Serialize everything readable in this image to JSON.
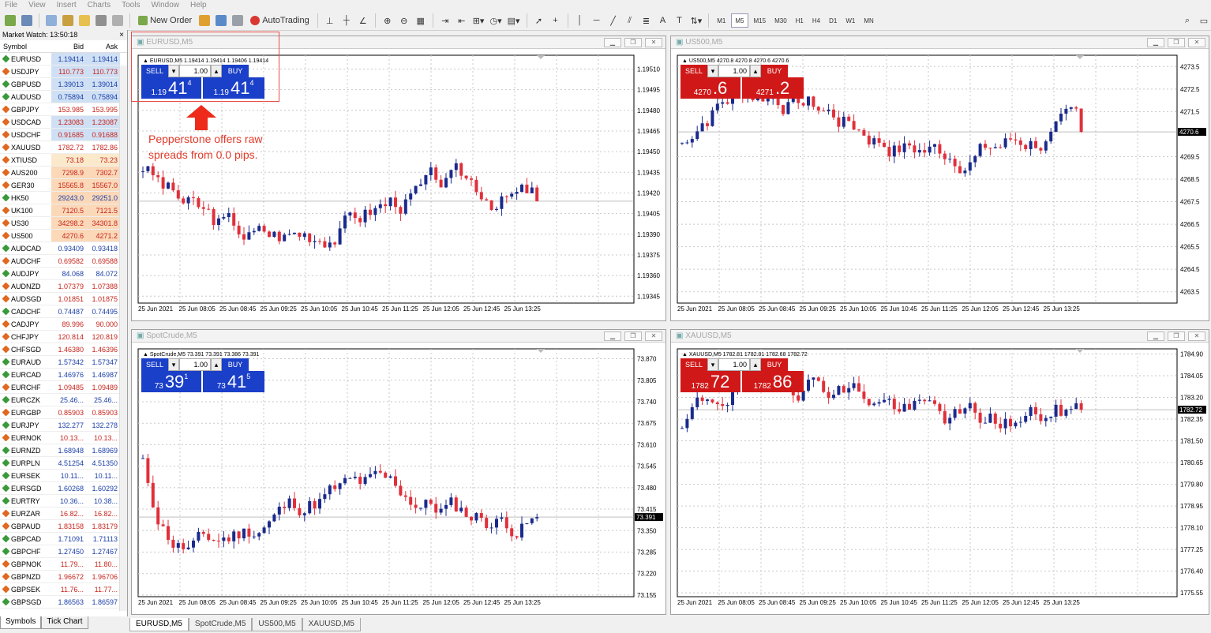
{
  "menu": [
    "File",
    "View",
    "Insert",
    "Charts",
    "Tools",
    "Window",
    "Help"
  ],
  "toolbar": {
    "new_order": "New Order",
    "autotrading": "AutoTrading",
    "timeframes": [
      "M1",
      "M5",
      "M15",
      "M30",
      "H1",
      "H4",
      "D1",
      "W1",
      "MN"
    ],
    "active_tf": "M5"
  },
  "market_watch": {
    "title": "Market Watch: 13:50:18",
    "headers": {
      "symbol": "Symbol",
      "bid": "Bid",
      "ask": "Ask"
    },
    "rows": [
      {
        "s": "EURUSD",
        "b": "1.19414",
        "a": "1.19414",
        "d": "up",
        "bg": "#cfe0f4",
        "c": "#1a3ea8"
      },
      {
        "s": "USDJPY",
        "b": "110.773",
        "a": "110.773",
        "d": "down",
        "bg": "#cfe0f4",
        "c": "#c8241b"
      },
      {
        "s": "GBPUSD",
        "b": "1.39013",
        "a": "1.39014",
        "d": "up",
        "bg": "#cfe0f4",
        "c": "#1a3ea8"
      },
      {
        "s": "AUDUSD",
        "b": "0.75894",
        "a": "0.75894",
        "d": "up",
        "bg": "#cfe0f4",
        "c": "#1a3ea8"
      },
      {
        "s": "GBPJPY",
        "b": "153.985",
        "a": "153.995",
        "d": "down",
        "bg": "#fff",
        "c": "#c8241b"
      },
      {
        "s": "USDCAD",
        "b": "1.23083",
        "a": "1.23087",
        "d": "down",
        "bg": "#cfe0f4",
        "c": "#c8241b"
      },
      {
        "s": "USDCHF",
        "b": "0.91685",
        "a": "0.91688",
        "d": "down",
        "bg": "#cfe0f4",
        "c": "#c8241b"
      },
      {
        "s": "XAUUSD",
        "b": "1782.72",
        "a": "1782.86",
        "d": "down",
        "bg": "#fff",
        "c": "#c8241b"
      },
      {
        "s": "XTIUSD",
        "b": "73.18",
        "a": "73.23",
        "d": "down",
        "bg": "#fbe9cc",
        "c": "#c8241b"
      },
      {
        "s": "AUS200",
        "b": "7298.9",
        "a": "7302.7",
        "d": "down",
        "bg": "#fbd8b8",
        "c": "#c8241b"
      },
      {
        "s": "GER30",
        "b": "15565.8",
        "a": "15567.0",
        "d": "down",
        "bg": "#fbd8b8",
        "c": "#c8241b"
      },
      {
        "s": "HK50",
        "b": "29243.0",
        "a": "29251.0",
        "d": "up",
        "bg": "#fbd8b8",
        "c": "#1a3ea8"
      },
      {
        "s": "UK100",
        "b": "7120.5",
        "a": "7121.5",
        "d": "down",
        "bg": "#fbd8b8",
        "c": "#c8241b"
      },
      {
        "s": "US30",
        "b": "34298.2",
        "a": "34301.8",
        "d": "down",
        "bg": "#fbd8b8",
        "c": "#c8241b"
      },
      {
        "s": "US500",
        "b": "4270.6",
        "a": "4271.2",
        "d": "down",
        "bg": "#fbd8b8",
        "c": "#c8241b"
      },
      {
        "s": "AUDCAD",
        "b": "0.93409",
        "a": "0.93418",
        "d": "up",
        "bg": "#fff",
        "c": "#1a3ea8"
      },
      {
        "s": "AUDCHF",
        "b": "0.69582",
        "a": "0.69588",
        "d": "down",
        "bg": "#fff",
        "c": "#c8241b"
      },
      {
        "s": "AUDJPY",
        "b": "84.068",
        "a": "84.072",
        "d": "up",
        "bg": "#fff",
        "c": "#1a3ea8"
      },
      {
        "s": "AUDNZD",
        "b": "1.07379",
        "a": "1.07388",
        "d": "down",
        "bg": "#fff",
        "c": "#c8241b"
      },
      {
        "s": "AUDSGD",
        "b": "1.01851",
        "a": "1.01875",
        "d": "down",
        "bg": "#fff",
        "c": "#c8241b"
      },
      {
        "s": "CADCHF",
        "b": "0.74487",
        "a": "0.74495",
        "d": "up",
        "bg": "#fff",
        "c": "#1a3ea8"
      },
      {
        "s": "CADJPY",
        "b": "89.996",
        "a": "90.000",
        "d": "down",
        "bg": "#fff",
        "c": "#c8241b"
      },
      {
        "s": "CHFJPY",
        "b": "120.814",
        "a": "120.819",
        "d": "down",
        "bg": "#fff",
        "c": "#c8241b"
      },
      {
        "s": "CHFSGD",
        "b": "1.46380",
        "a": "1.46396",
        "d": "down",
        "bg": "#fff",
        "c": "#c8241b"
      },
      {
        "s": "EURAUD",
        "b": "1.57342",
        "a": "1.57347",
        "d": "up",
        "bg": "#fff",
        "c": "#1a3ea8"
      },
      {
        "s": "EURCAD",
        "b": "1.46976",
        "a": "1.46987",
        "d": "up",
        "bg": "#fff",
        "c": "#1a3ea8"
      },
      {
        "s": "EURCHF",
        "b": "1.09485",
        "a": "1.09489",
        "d": "down",
        "bg": "#fff",
        "c": "#c8241b"
      },
      {
        "s": "EURCZK",
        "b": "25.46...",
        "a": "25.46...",
        "d": "up",
        "bg": "#fff",
        "c": "#1a3ea8"
      },
      {
        "s": "EURGBP",
        "b": "0.85903",
        "a": "0.85903",
        "d": "down",
        "bg": "#fff",
        "c": "#c8241b"
      },
      {
        "s": "EURJPY",
        "b": "132.277",
        "a": "132.278",
        "d": "up",
        "bg": "#fff",
        "c": "#1a3ea8"
      },
      {
        "s": "EURNOK",
        "b": "10.13...",
        "a": "10.13...",
        "d": "down",
        "bg": "#fff",
        "c": "#c8241b"
      },
      {
        "s": "EURNZD",
        "b": "1.68948",
        "a": "1.68969",
        "d": "up",
        "bg": "#fff",
        "c": "#1a3ea8"
      },
      {
        "s": "EURPLN",
        "b": "4.51254",
        "a": "4.51350",
        "d": "up",
        "bg": "#fff",
        "c": "#1a3ea8"
      },
      {
        "s": "EURSEK",
        "b": "10.11...",
        "a": "10.11...",
        "d": "up",
        "bg": "#fff",
        "c": "#1a3ea8"
      },
      {
        "s": "EURSGD",
        "b": "1.60268",
        "a": "1.60292",
        "d": "up",
        "bg": "#fff",
        "c": "#1a3ea8"
      },
      {
        "s": "EURTRY",
        "b": "10.36...",
        "a": "10.38...",
        "d": "up",
        "bg": "#fff",
        "c": "#1a3ea8"
      },
      {
        "s": "EURZAR",
        "b": "16.82...",
        "a": "16.82...",
        "d": "down",
        "bg": "#fff",
        "c": "#c8241b"
      },
      {
        "s": "GBPAUD",
        "b": "1.83158",
        "a": "1.83179",
        "d": "down",
        "bg": "#fff",
        "c": "#c8241b"
      },
      {
        "s": "GBPCAD",
        "b": "1.71091",
        "a": "1.71113",
        "d": "up",
        "bg": "#fff",
        "c": "#1a3ea8"
      },
      {
        "s": "GBPCHF",
        "b": "1.27450",
        "a": "1.27467",
        "d": "up",
        "bg": "#fff",
        "c": "#1a3ea8"
      },
      {
        "s": "GBPNOK",
        "b": "11.79...",
        "a": "11.80...",
        "d": "down",
        "bg": "#fff",
        "c": "#c8241b"
      },
      {
        "s": "GBPNZD",
        "b": "1.96672",
        "a": "1.96706",
        "d": "down",
        "bg": "#fff",
        "c": "#c8241b"
      },
      {
        "s": "GBPSEK",
        "b": "11.76...",
        "a": "11.77...",
        "d": "down",
        "bg": "#fff",
        "c": "#c8241b"
      },
      {
        "s": "GBPSGD",
        "b": "1.86563",
        "a": "1.86597",
        "d": "up",
        "bg": "#fff",
        "c": "#1a3ea8"
      }
    ],
    "tabs": [
      "Symbols",
      "Tick Chart"
    ]
  },
  "charts": [
    {
      "title": "EURUSD,M5",
      "info": "EURUSD,M5  1.19414 1.19414 1.19406 1.19414",
      "ticks": [
        "1.19510",
        "1.19495",
        "1.19480",
        "1.19465",
        "1.19450",
        "1.19435",
        "1.19420",
        "1.19405",
        "1.19390",
        "1.19375",
        "1.19360",
        "1.19345"
      ],
      "current": "1.19414",
      "ymin": 1.1934,
      "ymax": 1.1952,
      "last": 1.19414,
      "seed": 3,
      "theme": "blue",
      "otc": {
        "sell": "SELL",
        "buy": "BUY",
        "lot": "1.00",
        "sell_pre": "1.19",
        "sell_big": "41",
        "sell_sup": "4",
        "buy_pre": "1.19",
        "buy_big": "41",
        "buy_sup": "4"
      }
    },
    {
      "title": "US500,M5",
      "info": "US500,M5  4270.8 4270.8 4270.6 4270.6",
      "ticks": [
        "4273.5",
        "4272.5",
        "4271.5",
        "4270.6",
        "4269.5",
        "4268.5",
        "4267.5",
        "4266.5",
        "4265.5",
        "4264.5",
        "4263.5"
      ],
      "current": "4270.6",
      "ymin": 4263,
      "ymax": 4274,
      "last": 4270.6,
      "seed": 7,
      "theme": "red",
      "otc": {
        "sell": "SELL",
        "buy": "BUY",
        "lot": "1.00",
        "sell_pre": "4270",
        "sell_big": ".6",
        "sell_sup": "",
        "buy_pre": "4271",
        "buy_big": ".2",
        "buy_sup": ""
      }
    },
    {
      "title": "SpotCrude,M5",
      "info": "SpotCrude,M5  73.391 73.391 73.386 73.391",
      "ticks": [
        "73.870",
        "73.805",
        "73.740",
        "73.675",
        "73.610",
        "73.545",
        "73.480",
        "73.415",
        "73.391",
        "73.350",
        "73.285",
        "73.220",
        "73.155"
      ],
      "current": "73.391",
      "ymin": 73.15,
      "ymax": 73.9,
      "last": 73.391,
      "seed": 11,
      "theme": "blue",
      "otc": {
        "sell": "SELL",
        "buy": "BUY",
        "lot": "1.00",
        "sell_pre": "73",
        "sell_big": "39",
        "sell_sup": "1",
        "buy_pre": "73",
        "buy_big": "41",
        "buy_sup": "5"
      }
    },
    {
      "title": "XAUUSD,M5",
      "info": "XAUUSD,M5  1782.81 1782.81 1782.68 1782.72",
      "ticks": [
        "1784.90",
        "1784.05",
        "1783.20",
        "1782.72",
        "1782.35",
        "1781.50",
        "1780.65",
        "1779.80",
        "1778.95",
        "1778.10",
        "1777.25",
        "1776.40",
        "1775.55"
      ],
      "current": "1782.72",
      "ymin": 1775.4,
      "ymax": 1785.1,
      "last": 1782.72,
      "seed": 19,
      "theme": "red",
      "otc": {
        "sell": "SELL",
        "buy": "BUY",
        "lot": "1.00",
        "sell_pre": "1782",
        "sell_big": "72",
        "sell_sup": "",
        "buy_pre": "1782",
        "buy_big": "86",
        "buy_sup": ""
      }
    }
  ],
  "xlabels": [
    "25 Jun 2021",
    "25 Jun 08:05",
    "25 Jun 08:45",
    "25 Jun 09:25",
    "25 Jun 10:05",
    "25 Jun 10:45",
    "25 Jun 11:25",
    "25 Jun 12:05",
    "25 Jun 12:45",
    "25 Jun 13:25"
  ],
  "annotation": "Pepperstone offers raw spreads from 0.0 pips.",
  "bottom_tabs": [
    "EURUSD,M5",
    "SpotCrude,M5",
    "US500,M5",
    "XAUUSD,M5"
  ],
  "colors": {
    "bull": "#1a2a8c",
    "bear": "#e0303a",
    "blue_panel": "#1a3fc8",
    "red_panel": "#d01818"
  }
}
